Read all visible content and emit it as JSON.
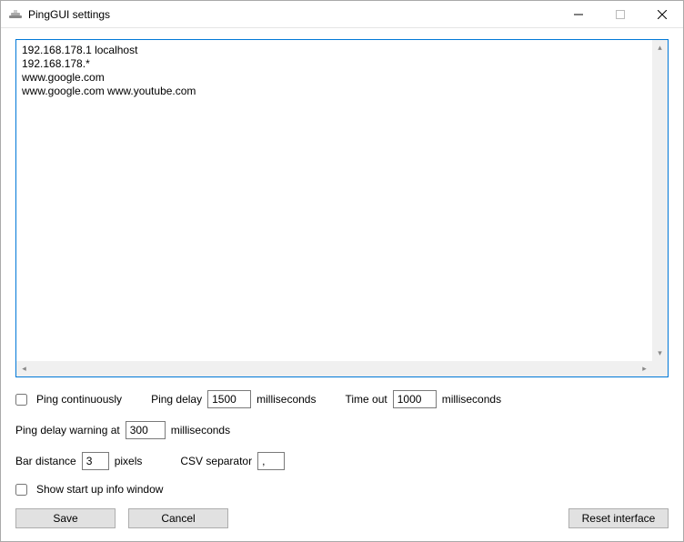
{
  "window": {
    "title": "PingGUI settings"
  },
  "hosts": "192.168.178.1 localhost\n192.168.178.*\nwww.google.com\nwww.google.com www.youtube.com",
  "form": {
    "ping_continuously_label": "Ping continuously",
    "ping_delay_label": "Ping delay",
    "ping_delay_value": "1500",
    "ping_delay_unit": "milliseconds",
    "timeout_label": "Time out",
    "timeout_value": "1000",
    "timeout_unit": "milliseconds",
    "ping_delay_warning_label": "Ping delay warning at",
    "ping_delay_warning_value": "300",
    "ping_delay_warning_unit": "milliseconds",
    "bar_distance_label": "Bar distance",
    "bar_distance_value": "3",
    "bar_distance_unit": "pixels",
    "csv_separator_label": "CSV separator",
    "csv_separator_value": ",",
    "show_startup_label": "Show start up info window"
  },
  "buttons": {
    "save": "Save",
    "cancel": "Cancel",
    "reset": "Reset interface"
  }
}
